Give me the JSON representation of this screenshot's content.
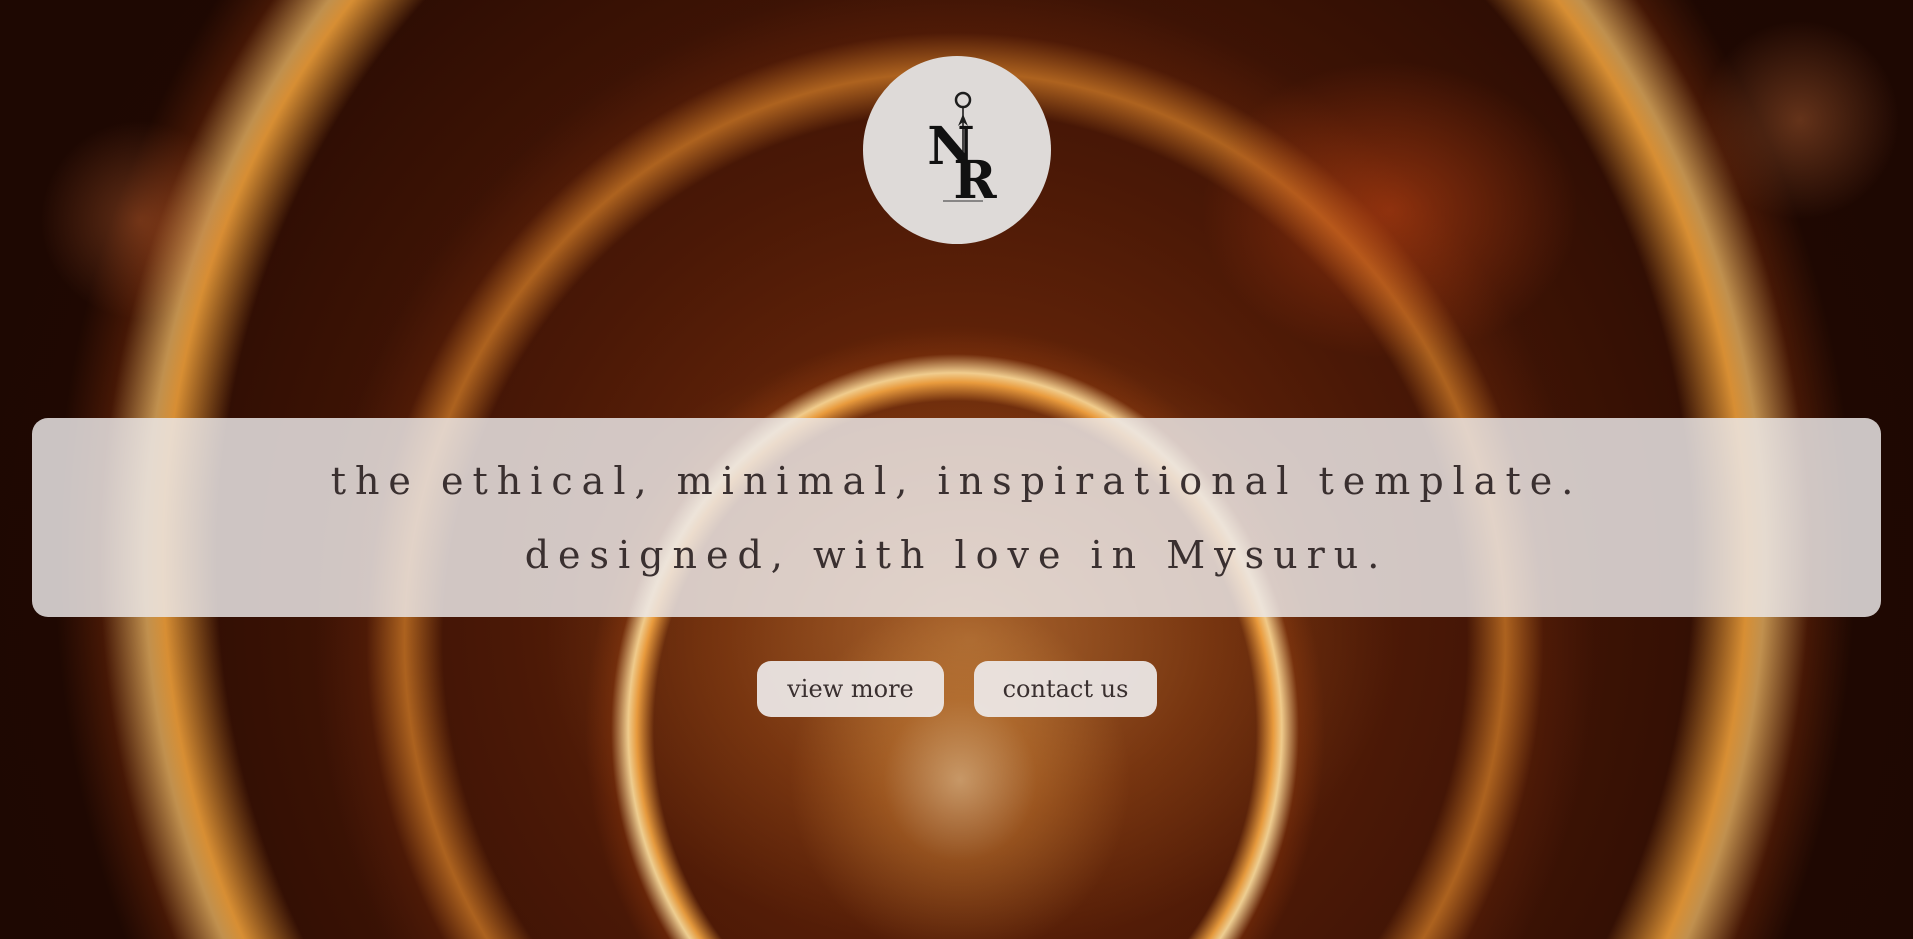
{
  "hero": {
    "background": "warm orange bokeh glass photo",
    "accent_colors": [
      "#2a0d04",
      "#e0963a",
      "#ffd9a0"
    ]
  },
  "logo": {
    "monogram_first": "N",
    "monogram_second": "R",
    "icon": "logo-icon"
  },
  "banner": {
    "line1": "the ethical, minimal, inspirational template.",
    "line2": "designed, with love in Mysuru."
  },
  "buttons": {
    "view_more": "view more",
    "contact_us": "contact us"
  }
}
